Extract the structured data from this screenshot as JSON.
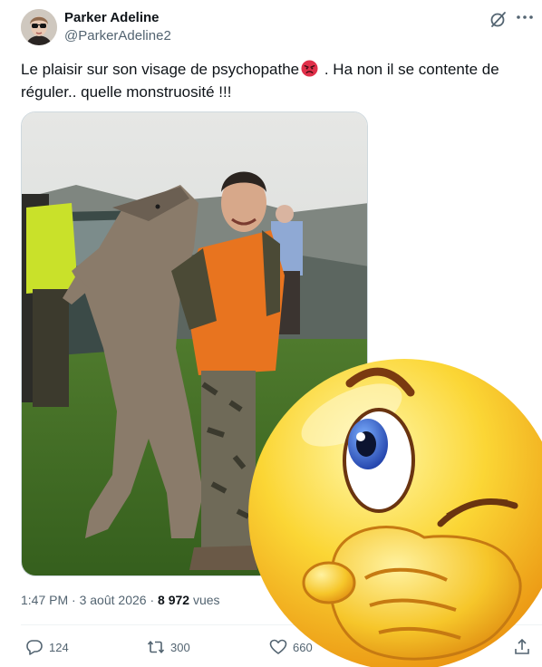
{
  "author": {
    "display_name": "Parker Adeline",
    "handle": "@ParkerAdeline2"
  },
  "icons": {
    "grok": "grok-icon",
    "more": "more-icon",
    "angry_face": "angry-face-emoji",
    "reply": "reply-icon",
    "retweet": "retweet-icon",
    "like": "heart-icon",
    "share": "share-icon",
    "overlay": "thinking-winking-emoji"
  },
  "tweet": {
    "text_before_emoji": "Le plaisir sur son visage de psychopathe",
    "text_after_emoji": " . Ha non il se contente de réguler.. quelle monstruosité !!!"
  },
  "meta": {
    "time": "1:47 PM",
    "separator": " · ",
    "date": "3 août 2026",
    "views_count": "8 972",
    "views_label": " vues"
  },
  "actions": {
    "replies": "124",
    "retweets": "300",
    "likes": "660"
  },
  "colors": {
    "text": "#0f1419",
    "secondary": "#536471",
    "border": "#cfd9de"
  }
}
